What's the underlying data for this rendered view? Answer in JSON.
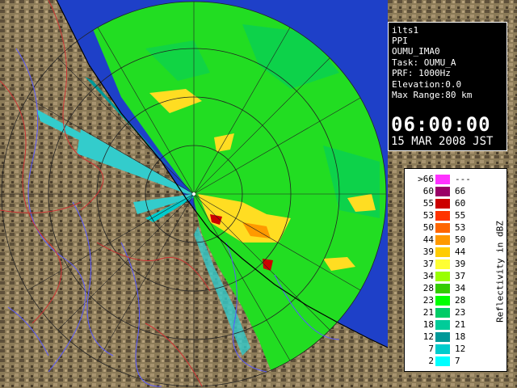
{
  "info": {
    "lines": [
      "ilts1",
      "PPI",
      "OUMU_IMA0",
      "Task: OUMU_A",
      "PRF: 1000Hz",
      "Elevation:0.0",
      "Max Range:80 km"
    ],
    "time": "06:00:00",
    "date": "15 MAR 2008 JST"
  },
  "legend": {
    "title": "Reflectivity in dBZ",
    "rows": [
      {
        "lo": ">66",
        "hi": "---",
        "color": "#ff33ff"
      },
      {
        "lo": "60",
        "hi": "66",
        "color": "#990066"
      },
      {
        "lo": "55",
        "hi": "60",
        "color": "#cc0000"
      },
      {
        "lo": "53",
        "hi": "55",
        "color": "#ff3300"
      },
      {
        "lo": "50",
        "hi": "53",
        "color": "#ff6600"
      },
      {
        "lo": "44",
        "hi": "50",
        "color": "#ff9900"
      },
      {
        "lo": "39",
        "hi": "44",
        "color": "#ffcc00"
      },
      {
        "lo": "37",
        "hi": "39",
        "color": "#ffff33"
      },
      {
        "lo": "34",
        "hi": "37",
        "color": "#99ff00"
      },
      {
        "lo": "28",
        "hi": "34",
        "color": "#33cc00"
      },
      {
        "lo": "23",
        "hi": "28",
        "color": "#00ff00"
      },
      {
        "lo": "21",
        "hi": "23",
        "color": "#00cc66"
      },
      {
        "lo": "18",
        "hi": "21",
        "color": "#00cc99"
      },
      {
        "lo": "12",
        "hi": "18",
        "color": "#009999"
      },
      {
        "lo": "7",
        "hi": "12",
        "color": "#00cccc"
      },
      {
        "lo": "2",
        "hi": "7",
        "color": "#00ffff"
      }
    ]
  },
  "colors": {
    "sea": "#1e40c8",
    "land": "#8a7a5a",
    "echo_green": "#22dd22",
    "echo_yellow": "#ffdd22",
    "echo_cyan": "#33cccc",
    "rivers": "#5a5aff",
    "borders": "#cc3333"
  }
}
